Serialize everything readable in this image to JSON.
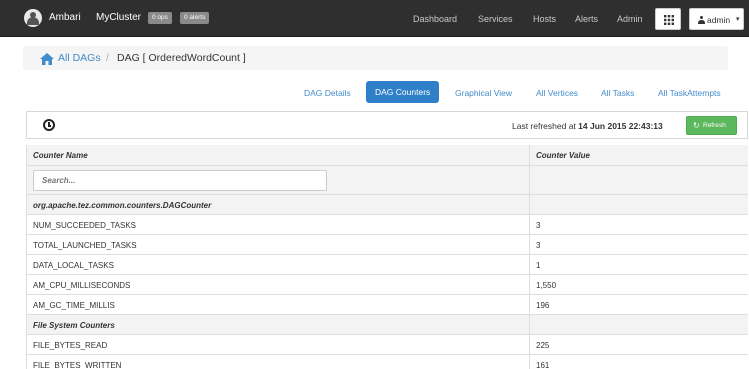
{
  "nav": {
    "brand": "Ambari",
    "cluster": "MyCluster",
    "ops_badge": "0 ops",
    "alerts_badge": "0 alerts",
    "links": [
      "Dashboard",
      "Services",
      "Hosts",
      "Alerts",
      "Admin"
    ],
    "user": "admin"
  },
  "breadcrumb": {
    "root": "All DAGs",
    "separator": "/",
    "current": "DAG [ OrderedWordCount ]"
  },
  "tabs": [
    {
      "label": "DAG Details",
      "active": false
    },
    {
      "label": "DAG Counters",
      "active": true
    },
    {
      "label": "Graphical View",
      "active": false
    },
    {
      "label": "All Vertices",
      "active": false
    },
    {
      "label": "All Tasks",
      "active": false
    },
    {
      "label": "All TaskAttempts",
      "active": false
    }
  ],
  "refresh": {
    "prefix": "Last refreshed at",
    "timestamp": "14 Jun 2015 22:43:13",
    "button_label": "Refresh"
  },
  "table": {
    "col_name": "Counter Name",
    "col_value": "Counter Value",
    "search_placeholder": "Search...",
    "rows": [
      {
        "type": "group",
        "name": "org.apache.tez.common.counters.DAGCounter",
        "value": ""
      },
      {
        "type": "data",
        "name": "NUM_SUCCEEDED_TASKS",
        "value": "3"
      },
      {
        "type": "data",
        "name": "TOTAL_LAUNCHED_TASKS",
        "value": "3"
      },
      {
        "type": "data",
        "name": "DATA_LOCAL_TASKS",
        "value": "1"
      },
      {
        "type": "data",
        "name": "AM_CPU_MILLISECONDS",
        "value": "1,550"
      },
      {
        "type": "data",
        "name": "AM_GC_TIME_MILLIS",
        "value": "196"
      },
      {
        "type": "group",
        "name": "File System Counters",
        "value": ""
      },
      {
        "type": "data",
        "name": "FILE_BYTES_READ",
        "value": "225"
      },
      {
        "type": "data",
        "name": "FILE_BYTES_WRITTEN",
        "value": "161"
      }
    ]
  },
  "colors": {
    "topbar": "#2f2f2f",
    "link": "#428bca",
    "active_tab": "#2f80c9",
    "refresh_button": "#5cb85c"
  }
}
